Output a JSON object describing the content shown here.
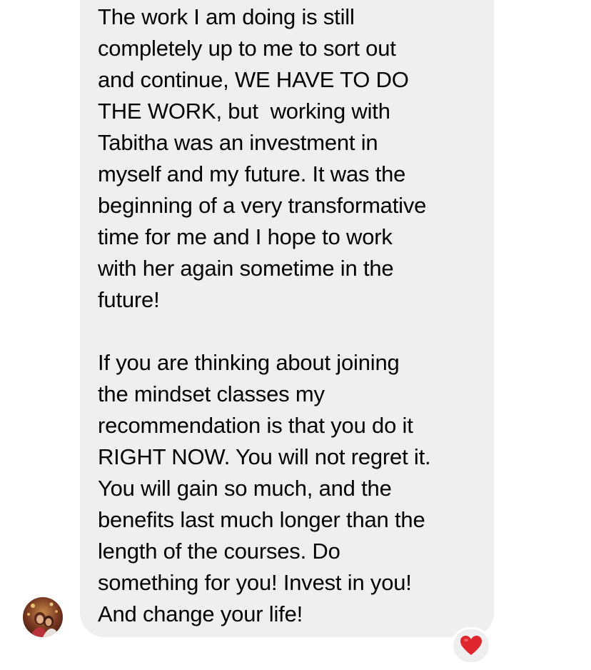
{
  "message": {
    "paragraph_1": [
      "The work I am doing is still",
      "completely up to me to sort out",
      "and continue, WE HAVE TO DO",
      "THE WORK, but  working with",
      "Tabitha was an investment in",
      "myself and my future. It was the",
      "beginning of a very transformative",
      "time for me and I hope to work",
      "with her again sometime in the",
      "future!"
    ],
    "paragraph_2": [
      "If you are thinking about joining",
      "the mindset classes my",
      "recommendation is that you do it",
      "RIGHT NOW. You will not regret it.",
      "You will gain so much, and the",
      "benefits last much longer than the",
      "length of the courses. Do",
      "something for you! Invest in you!",
      "And change your life!"
    ]
  },
  "reaction": {
    "icon": "heart-icon",
    "color": "#e0262f"
  },
  "avatar": {
    "icon": "avatar-photo"
  },
  "colors": {
    "bubble": "#efefef",
    "background": "#ffffff",
    "text": "#000000"
  }
}
